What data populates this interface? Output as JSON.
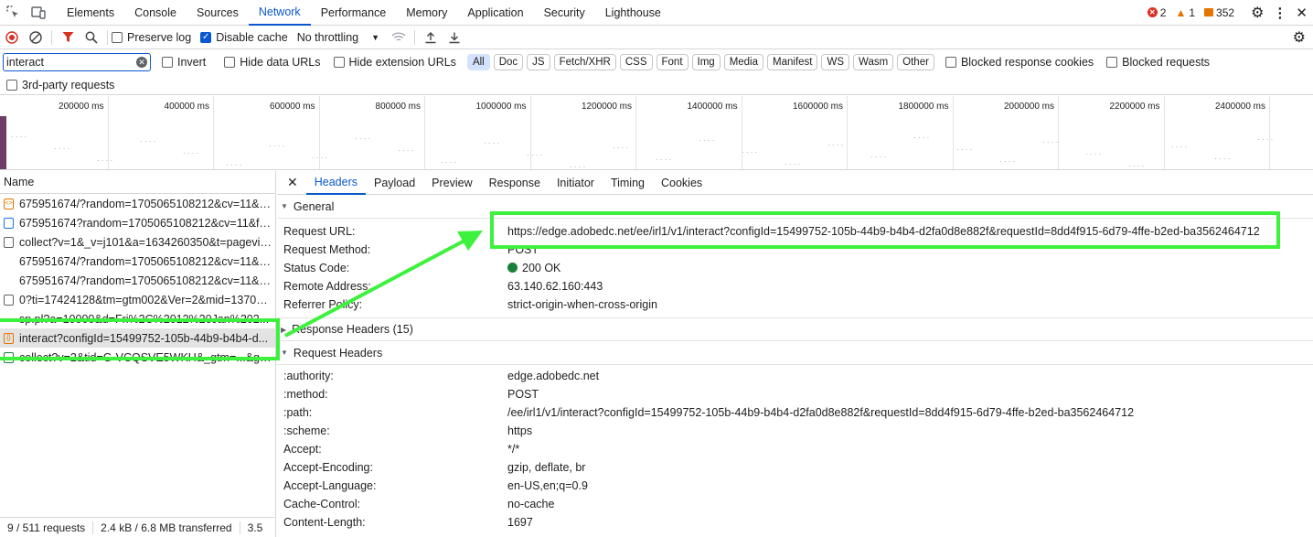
{
  "topbar": {
    "tabs": [
      "Elements",
      "Console",
      "Sources",
      "Network",
      "Performance",
      "Memory",
      "Application",
      "Security",
      "Lighthouse"
    ],
    "active_tab": "Network",
    "errors": "2",
    "warnings": "1",
    "issues": "352"
  },
  "toolbar": {
    "preserve_log": "Preserve log",
    "disable_cache": "Disable cache",
    "throttling": "No throttling"
  },
  "filter": {
    "search_value": "interact",
    "invert": "Invert",
    "hide_data_urls": "Hide data URLs",
    "hide_extension_urls": "Hide extension URLs",
    "chips": [
      "All",
      "Doc",
      "JS",
      "Fetch/XHR",
      "CSS",
      "Font",
      "Img",
      "Media",
      "Manifest",
      "WS",
      "Wasm",
      "Other"
    ],
    "active_chip": "All",
    "blocked_cookies": "Blocked response cookies",
    "blocked_requests": "Blocked requests",
    "third_party": "3rd-party requests"
  },
  "overview": {
    "ticks": [
      "200000 ms",
      "400000 ms",
      "600000 ms",
      "800000 ms",
      "1000000 ms",
      "1200000 ms",
      "1400000 ms",
      "1600000 ms",
      "1800000 ms",
      "2000000 ms",
      "2200000 ms",
      "2400000 ms"
    ]
  },
  "requests": {
    "header": "Name",
    "items": [
      {
        "name": "675951674/?random=1705065108212&cv=11&fst=...",
        "icon": "script-icon",
        "color": "#e37400"
      },
      {
        "name": "675951674?random=1705065108212&cv=11&fst=...",
        "icon": "document-icon",
        "color": "#1a73e8"
      },
      {
        "name": "collect?v=1&_v=j101&a=1634260350&t=pageview...",
        "icon": "file-icon",
        "color": "#5f6368"
      },
      {
        "name": "675951674/?random=1705065108212&cv=11&fs...",
        "icon": "none",
        "color": "#ffffff"
      },
      {
        "name": "675951674/?random=1705065108212&cv=11&fs...",
        "icon": "none",
        "color": "#ffffff"
      },
      {
        "name": "0?ti=17424128&tm=gtm002&Ver=2&mid=137011...",
        "icon": "image-icon",
        "color": "#5f6368"
      },
      {
        "name": "sp.pl?a=10000&d=Fri%2C%2012%20Jan%202...",
        "icon": "none",
        "color": "#ffffff"
      },
      {
        "name": "interact?configId=15499752-105b-44b9-b4b4-d...",
        "icon": "fetch-icon",
        "color": "#e37400"
      },
      {
        "name": "collect?v=2&tid=G-VCQSVE5WKH&_gtm=...&gtm...",
        "icon": "file-icon",
        "color": "#188038"
      }
    ],
    "selected_index": 7
  },
  "status": {
    "requests": "9 / 511 requests",
    "transferred": "2.4 kB / 6.8 MB transferred",
    "resources": "3.5"
  },
  "details": {
    "tabs": [
      "Headers",
      "Payload",
      "Preview",
      "Response",
      "Initiator",
      "Timing",
      "Cookies"
    ],
    "active_tab": "Headers",
    "general_title": "General",
    "general": [
      {
        "k": "Request URL:",
        "v": "https://edge.adobedc.net/ee/irl1/v1/interact?configId=15499752-105b-44b9-b4b4-d2fa0d8e882f&requestId=8dd4f915-6d79-4ffe-b2ed-ba3562464712"
      },
      {
        "k": "Request Method:",
        "v": "POST"
      },
      {
        "k": "Status Code:",
        "v": "200 OK"
      },
      {
        "k": "Remote Address:",
        "v": "63.140.62.160:443"
      },
      {
        "k": "Referrer Policy:",
        "v": "strict-origin-when-cross-origin"
      }
    ],
    "response_headers_title": "Response Headers (15)",
    "request_headers_title": "Request Headers",
    "request_headers": [
      {
        "k": ":authority:",
        "v": "edge.adobedc.net"
      },
      {
        "k": ":method:",
        "v": "POST"
      },
      {
        "k": ":path:",
        "v": "/ee/irl1/v1/interact?configId=15499752-105b-44b9-b4b4-d2fa0d8e882f&requestId=8dd4f915-6d79-4ffe-b2ed-ba3562464712"
      },
      {
        "k": ":scheme:",
        "v": "https"
      },
      {
        "k": "Accept:",
        "v": "*/*"
      },
      {
        "k": "Accept-Encoding:",
        "v": "gzip, deflate, br"
      },
      {
        "k": "Accept-Language:",
        "v": "en-US,en;q=0.9"
      },
      {
        "k": "Cache-Control:",
        "v": "no-cache"
      },
      {
        "k": "Content-Length:",
        "v": "1697"
      }
    ]
  },
  "colors": {
    "accent": "#0b57d0",
    "highlight": "#3cf23c",
    "error": "#d93025",
    "warning": "#e37400",
    "ok": "#188038"
  }
}
